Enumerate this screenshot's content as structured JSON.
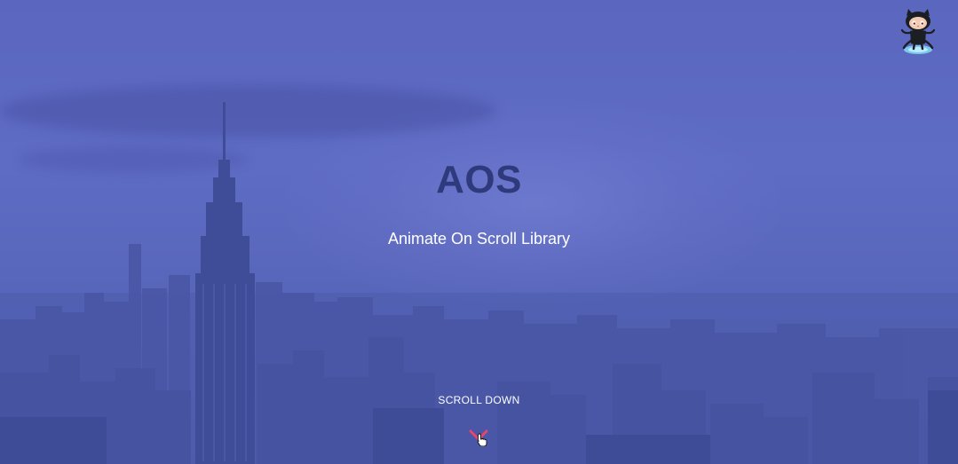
{
  "hero": {
    "title": "AOS",
    "subtitle": "Animate On Scroll Library",
    "scroll_label": "SCROLL DOWN"
  },
  "icons": {
    "github": "github-octocat-icon",
    "scroll": "chevron-down-icon",
    "cursor": "hand-pointer-cursor"
  },
  "colors": {
    "overlay": "#5b67bf",
    "title": "#2f3a7d",
    "subtitle": "#ffffff",
    "chevron": "#e8456b"
  }
}
